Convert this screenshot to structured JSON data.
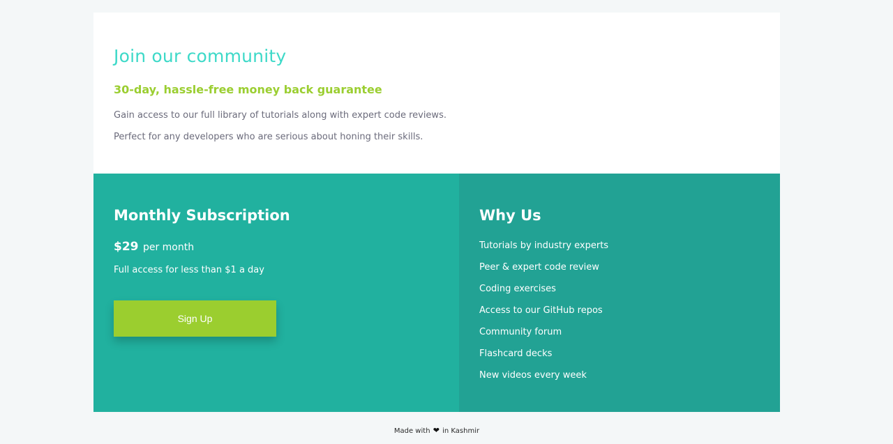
{
  "intro": {
    "heading": "Join our community",
    "subheading": "30-day, hassle-free money back guarantee",
    "paragraphs": [
      "Gain access to our full library of tutorials along with expert code reviews.",
      "Perfect for any developers who are serious about honing their skills."
    ]
  },
  "subscription": {
    "title": "Monthly Subscription",
    "price": "$29",
    "period": "per month",
    "description": "Full access for less than $1 a day",
    "cta_label": "Sign Up"
  },
  "why_us": {
    "title": "Why Us",
    "items": [
      "Tutorials by industry experts",
      "Peer & expert code review",
      "Coding exercises",
      "Access to our GitHub repos",
      "Community forum",
      "Flashcard decks",
      "New videos every week"
    ]
  },
  "footer": {
    "prefix": "Made with",
    "icon": "heart-icon",
    "suffix": "in Kashmir"
  },
  "colors": {
    "page_background": "#f4f7f8",
    "heading_teal": "#3dd9c8",
    "guarantee_green": "#9bce31",
    "subscription_panel": "#21b19f",
    "why_panel": "#22a294",
    "button": "#9bce2f"
  }
}
